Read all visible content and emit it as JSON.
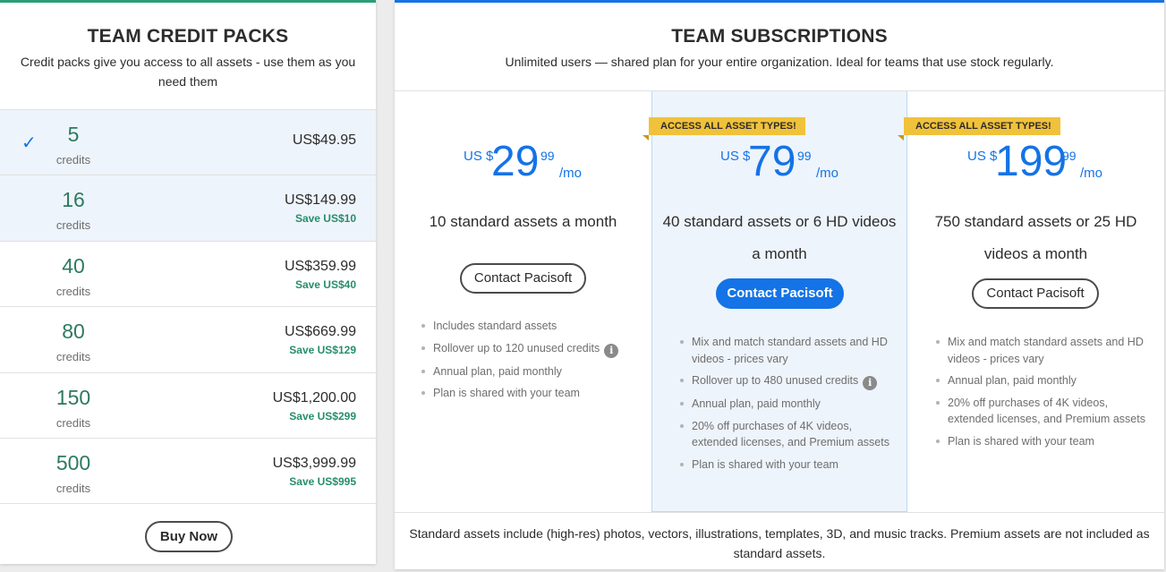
{
  "credit_packs": {
    "title": "TEAM CREDIT PACKS",
    "subtitle": "Credit packs give you access to all assets - use them as you need them",
    "credits_label": "credits",
    "checkmark": "✓",
    "packs": [
      {
        "count": "5",
        "price": "US$49.95",
        "save": ""
      },
      {
        "count": "16",
        "price": "US$149.99",
        "save": "Save US$10"
      },
      {
        "count": "40",
        "price": "US$359.99",
        "save": "Save US$40"
      },
      {
        "count": "80",
        "price": "US$669.99",
        "save": "Save US$129"
      },
      {
        "count": "150",
        "price": "US$1,200.00",
        "save": "Save US$299"
      },
      {
        "count": "500",
        "price": "US$3,999.99",
        "save": "Save US$995"
      }
    ],
    "buy_label": "Buy Now"
  },
  "subscriptions": {
    "title": "TEAM SUBSCRIPTIONS",
    "subtitle": "Unlimited users — shared plan for your entire organization. Ideal for teams that use stock regularly.",
    "plans": [
      {
        "badge": "",
        "currency": "US $",
        "amount": "29",
        "cents": "99",
        "period": "/mo",
        "description": "10 standard assets a month",
        "cta": "Contact Pacisoft",
        "features": [
          "Includes standard assets",
          "Rollover up to 120 unused credits",
          "Annual plan, paid monthly",
          "Plan is shared with your team"
        ]
      },
      {
        "badge": "ACCESS ALL ASSET TYPES!",
        "currency": "US $",
        "amount": "79",
        "cents": "99",
        "period": "/mo",
        "description": "40 standard assets or 6 HD videos a month",
        "cta": "Contact Pacisoft",
        "features": [
          "Mix and match standard assets and HD videos - prices vary",
          "Rollover up to 480 unused credits",
          "Annual plan, paid monthly",
          "20% off purchases of 4K videos, extended licenses, and Premium assets",
          "Plan is shared with your team"
        ]
      },
      {
        "badge": "ACCESS ALL ASSET TYPES!",
        "currency": "US $",
        "amount": "199",
        "cents": "99",
        "period": "/mo",
        "description": "750 standard assets or 25 HD videos a month",
        "cta": "Contact Pacisoft",
        "features": [
          "Mix and match standard assets and HD videos - prices vary",
          "Annual plan, paid monthly",
          "20% off purchases of 4K videos, extended licenses, and Premium assets",
          "Plan is shared with your team"
        ]
      }
    ],
    "info_glyph": "i",
    "footnote": "Standard assets include (high-res) photos, vectors, illustrations, templates, 3D, and music tracks. Premium assets are not included as standard assets."
  },
  "colors": {
    "accent_blue": "#1473e6",
    "credit_green": "#2d9d78",
    "badge_yellow": "#f0c23b",
    "highlight_bg": "#eef4fb"
  }
}
